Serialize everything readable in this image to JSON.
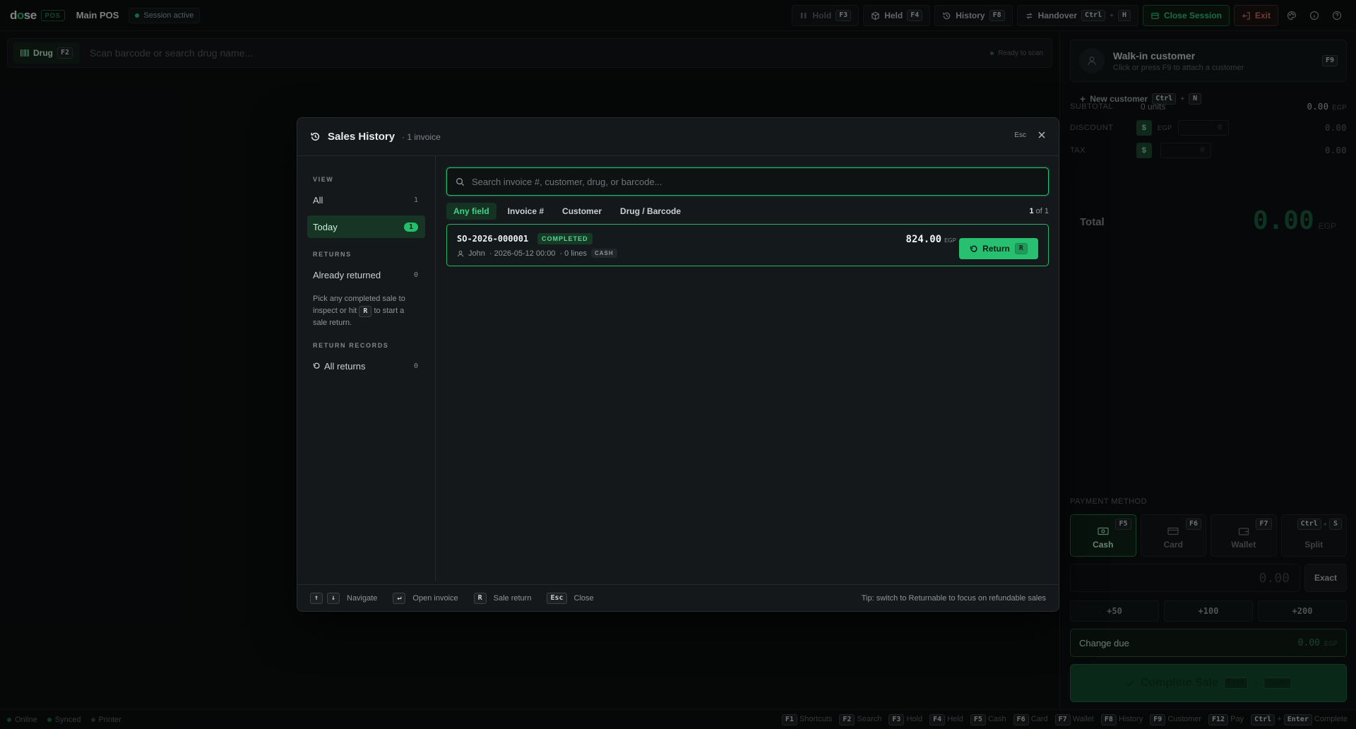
{
  "app": {
    "logo_a": "d",
    "logo_o": "o",
    "logo_b": "se",
    "pos_badge": "POS",
    "store": "Main POS",
    "session": "Session active"
  },
  "toolbar": {
    "hold": {
      "label": "Hold",
      "key": "F3"
    },
    "held": {
      "label": "Held",
      "key": "F4"
    },
    "history": {
      "label": "History",
      "key": "F8"
    },
    "handover": {
      "label": "Handover",
      "key1": "Ctrl",
      "plus": "+",
      "key2": "H"
    },
    "close_session": "Close Session",
    "exit": "Exit"
  },
  "scan": {
    "mode_label": "Drug",
    "mode_key": "F2",
    "placeholder": "Scan barcode or search drug name...",
    "ready": "Ready to scan"
  },
  "cart": {
    "customer_name": "Walk-in customer",
    "customer_hint": "Click or press F9 to attach a customer",
    "customer_key": "F9",
    "new_customer": "New customer",
    "new_key1": "Ctrl",
    "new_plus": "+",
    "new_key2": "N",
    "subtotal_label": "SUBTOTAL",
    "subtotal_units": "0 units",
    "subtotal_value": "0.00",
    "currency": "EGP",
    "discount_label": "DISCOUNT",
    "discount_mode": "$",
    "discount_input": "0",
    "discount_value": "0.00",
    "tax_label": "TAX",
    "tax_mode": "$",
    "tax_input": "0",
    "tax_value": "0.00",
    "total_label": "Total",
    "total_value": "0.00"
  },
  "payment": {
    "label": "PAYMENT METHOD",
    "methods": [
      {
        "label": "Cash",
        "key": "F5"
      },
      {
        "label": "Card",
        "key": "F6"
      },
      {
        "label": "Wallet",
        "key": "F7"
      },
      {
        "label": "Split",
        "key1": "Ctrl",
        "plus": "+",
        "key2": "S"
      }
    ],
    "amount": "0.00",
    "exact": "Exact",
    "quick": [
      "+50",
      "+100",
      "+200"
    ],
    "change_label": "Change due",
    "change_value": "0.00",
    "complete_label": "Complete Sale",
    "complete_key1": "Ctrl",
    "complete_plus": "+",
    "complete_key2": "Enter"
  },
  "statusbar": {
    "online": "Online",
    "synced": "Synced",
    "printer": "Printer",
    "shortcuts": [
      {
        "key": "F1",
        "label": "Shortcuts"
      },
      {
        "key": "F2",
        "label": "Search"
      },
      {
        "key": "F3",
        "label": "Hold"
      },
      {
        "key": "F4",
        "label": "Held"
      },
      {
        "key": "F5",
        "label": "Cash"
      },
      {
        "key": "F6",
        "label": "Card"
      },
      {
        "key": "F7",
        "label": "Wallet"
      },
      {
        "key": "F8",
        "label": "History"
      },
      {
        "key": "F9",
        "label": "Customer"
      },
      {
        "key": "F12",
        "label": "Pay"
      }
    ],
    "complete_key1": "Ctrl",
    "complete_plus": "+",
    "complete_key2": "Enter",
    "complete_label": "Complete"
  },
  "modal": {
    "title": "Sales History",
    "count": "· 1 invoice",
    "esc": "Esc",
    "view_label": "VIEW",
    "all": {
      "label": "All",
      "count": "1"
    },
    "today": {
      "label": "Today",
      "count": "1"
    },
    "returns_label": "RETURNS",
    "already_returned": {
      "label": "Already returned",
      "count": "0"
    },
    "hint_a": "Pick any completed sale to inspect or hit",
    "hint_key": "R",
    "hint_b": "to start a sale return.",
    "records_label": "RETURN RECORDS",
    "all_returns": {
      "label": "All returns",
      "count": "0"
    },
    "search_placeholder": "Search invoice #, customer, drug, or barcode...",
    "filters": [
      "Any field",
      "Invoice #",
      "Customer",
      "Drug / Barcode"
    ],
    "page_current": "1",
    "page_rest": " of 1",
    "invoice": {
      "id": "SO-2026-000001",
      "status": "COMPLETED",
      "customer": "John",
      "date": "· 2026-05-12 00:00",
      "lines": "· 0 lines",
      "method": "CASH",
      "amount": "824.00",
      "currency": "EGP",
      "return_label": "Return",
      "return_key": "R"
    },
    "footer": {
      "up": "↑",
      "down": "↓",
      "navigate": "Navigate",
      "enter": "↵",
      "open": "Open invoice",
      "r": "R",
      "sale_return": "Sale return",
      "esc": "Esc",
      "close": "Close",
      "tip": "Tip: switch to Returnable to focus on refundable sales"
    }
  },
  "colors": {
    "accent": "#27c070",
    "bg": "#0b0d0e",
    "modal_bg": "#14181a"
  }
}
